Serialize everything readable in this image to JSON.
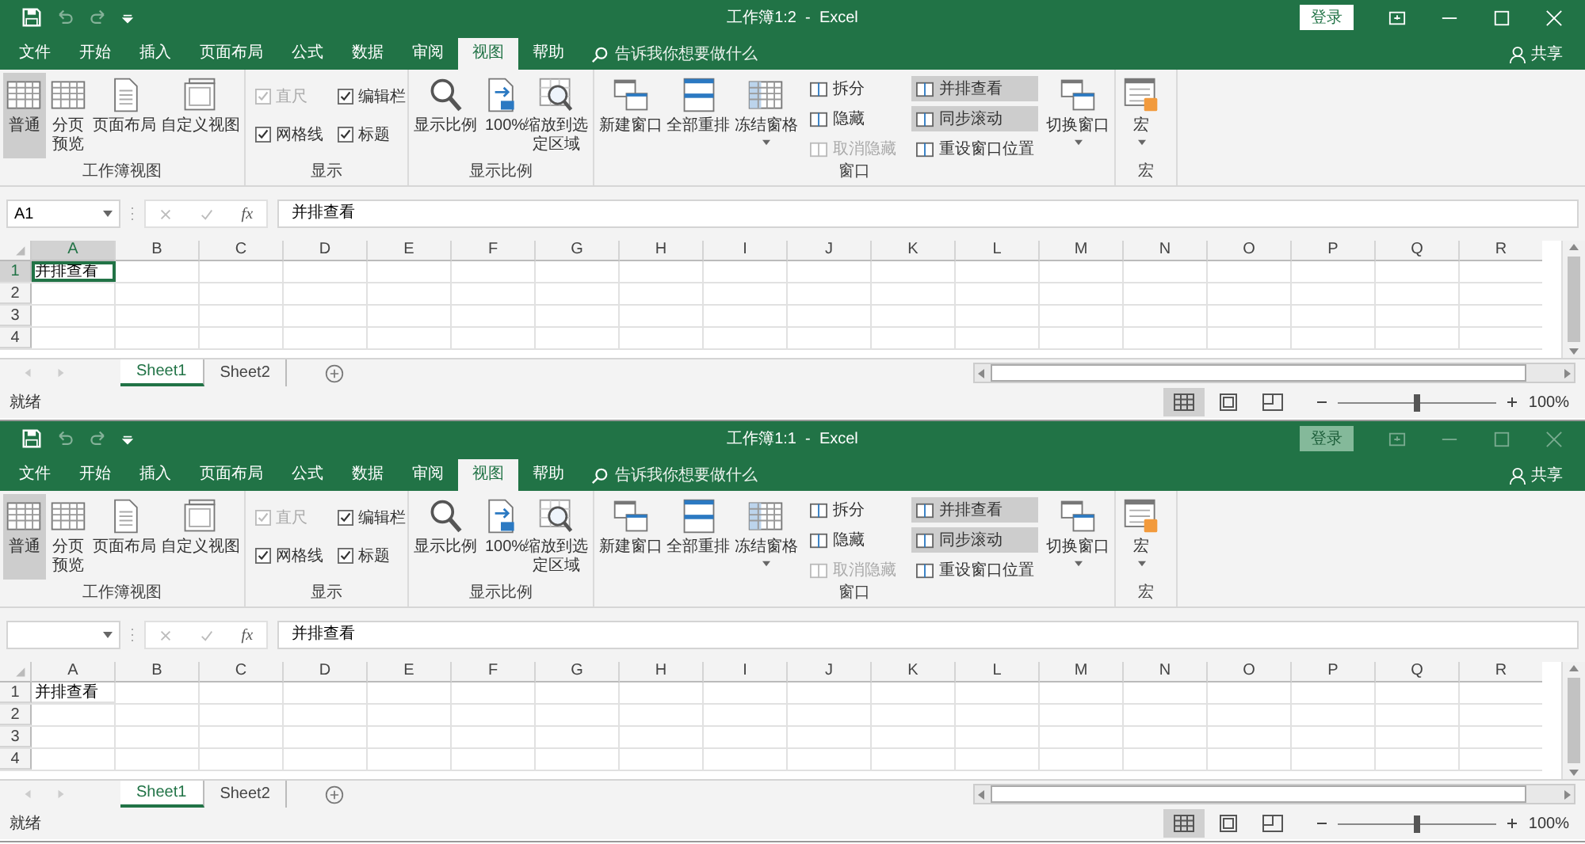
{
  "windows": [
    {
      "active": true,
      "title": "工作簿1:2  -  Excel",
      "login": "登录",
      "share": "共享",
      "tabs": [
        {
          "label": "文件",
          "selected": false
        },
        {
          "label": "开始",
          "selected": false
        },
        {
          "label": "插入",
          "selected": false
        },
        {
          "label": "页面布局",
          "selected": false
        },
        {
          "label": "公式",
          "selected": false
        },
        {
          "label": "数据",
          "selected": false
        },
        {
          "label": "审阅",
          "selected": false
        },
        {
          "label": "视图",
          "selected": true
        },
        {
          "label": "帮助",
          "selected": false
        }
      ],
      "tell_me": "告诉我你想要做什么",
      "groups": [
        {
          "label": "工作簿视图",
          "items": [
            {
              "kind": "large",
              "label": "普通",
              "selected": true
            },
            {
              "kind": "large",
              "label": "分页预览",
              "selected": false
            },
            {
              "kind": "large",
              "label": "页面布局",
              "selected": false
            },
            {
              "kind": "large",
              "label": "自定义视图",
              "selected": false
            }
          ]
        },
        {
          "label": "显示",
          "items": [
            {
              "kind": "column",
              "items": [
                {
                  "kind": "check",
                  "label": "直尺",
                  "checked": true,
                  "disabled": true
                },
                {
                  "kind": "check",
                  "label": "网格线",
                  "checked": true,
                  "disabled": false
                }
              ]
            },
            {
              "kind": "column",
              "items": [
                {
                  "kind": "check",
                  "label": "编辑栏",
                  "checked": true,
                  "disabled": false
                },
                {
                  "kind": "check",
                  "label": "标题",
                  "checked": true,
                  "disabled": false
                }
              ]
            }
          ]
        },
        {
          "label": "显示比例",
          "items": [
            {
              "kind": "large",
              "label": "显示比例",
              "selected": false
            },
            {
              "kind": "large",
              "label": "100%",
              "selected": false
            },
            {
              "kind": "large",
              "label": "缩放到选定区域",
              "selected": false
            }
          ]
        },
        {
          "label": "窗口",
          "items": [
            {
              "kind": "large",
              "label": "新建窗口",
              "selected": false
            },
            {
              "kind": "large",
              "label": "全部重排",
              "selected": false
            },
            {
              "kind": "large",
              "label": "冻结窗格",
              "selected": false,
              "dropdown": true
            },
            {
              "kind": "column",
              "items": [
                {
                  "kind": "small",
                  "label": "拆分",
                  "selected": false,
                  "disabled": false
                },
                {
                  "kind": "small",
                  "label": "隐藏",
                  "selected": false,
                  "disabled": false
                },
                {
                  "kind": "small",
                  "label": "取消隐藏",
                  "selected": false,
                  "disabled": true
                }
              ]
            },
            {
              "kind": "column",
              "items": [
                {
                  "kind": "small",
                  "label": "并排查看",
                  "selected": true,
                  "disabled": false
                },
                {
                  "kind": "small",
                  "label": "同步滚动",
                  "selected": true,
                  "disabled": false
                },
                {
                  "kind": "small",
                  "label": "重设窗口位置",
                  "selected": false,
                  "disabled": false
                }
              ]
            },
            {
              "kind": "large",
              "label": "切换窗口",
              "selected": false,
              "dropdown": true
            }
          ]
        },
        {
          "label": "宏",
          "items": [
            {
              "kind": "large",
              "label": "宏",
              "selected": false,
              "dropdown": true
            }
          ]
        }
      ],
      "name_box": "A1",
      "fx": "fx",
      "formula": "并排查看",
      "columns": [
        "A",
        "B",
        "C",
        "D",
        "E",
        "F",
        "G",
        "H",
        "I",
        "J",
        "K",
        "L",
        "M",
        "N",
        "O",
        "P",
        "Q",
        "R"
      ],
      "rows": [
        {
          "header": "1",
          "cells": [
            {
              "text": "并排查看",
              "selected": true
            }
          ]
        },
        {
          "header": "2",
          "cells": []
        },
        {
          "header": "3",
          "cells": []
        },
        {
          "header": "4",
          "cells": []
        }
      ],
      "sheets": [
        {
          "label": "Sheet1",
          "selected": true
        },
        {
          "label": "Sheet2",
          "selected": false
        }
      ],
      "status": "就绪",
      "zoom": {
        "level": 0.5,
        "reading": "100%"
      }
    },
    {
      "active": false,
      "title": "工作簿1:1  -  Excel",
      "login": "登录",
      "share": "共享",
      "tabs": [
        {
          "label": "文件",
          "selected": false
        },
        {
          "label": "开始",
          "selected": false
        },
        {
          "label": "插入",
          "selected": false
        },
        {
          "label": "页面布局",
          "selected": false
        },
        {
          "label": "公式",
          "selected": false
        },
        {
          "label": "数据",
          "selected": false
        },
        {
          "label": "审阅",
          "selected": false
        },
        {
          "label": "视图",
          "selected": true
        },
        {
          "label": "帮助",
          "selected": false
        }
      ],
      "tell_me": "告诉我你想要做什么",
      "groups": [
        {
          "label": "工作簿视图",
          "items": [
            {
              "kind": "large",
              "label": "普通",
              "selected": true
            },
            {
              "kind": "large",
              "label": "分页预览",
              "selected": false
            },
            {
              "kind": "large",
              "label": "页面布局",
              "selected": false
            },
            {
              "kind": "large",
              "label": "自定义视图",
              "selected": false
            }
          ]
        },
        {
          "label": "显示",
          "items": [
            {
              "kind": "column",
              "items": [
                {
                  "kind": "check",
                  "label": "直尺",
                  "checked": true,
                  "disabled": true
                },
                {
                  "kind": "check",
                  "label": "网格线",
                  "checked": true,
                  "disabled": false
                }
              ]
            },
            {
              "kind": "column",
              "items": [
                {
                  "kind": "check",
                  "label": "编辑栏",
                  "checked": true,
                  "disabled": false
                },
                {
                  "kind": "check",
                  "label": "标题",
                  "checked": true,
                  "disabled": false
                }
              ]
            }
          ]
        },
        {
          "label": "显示比例",
          "items": [
            {
              "kind": "large",
              "label": "显示比例",
              "selected": false
            },
            {
              "kind": "large",
              "label": "100%",
              "selected": false
            },
            {
              "kind": "large",
              "label": "缩放到选定区域",
              "selected": false
            }
          ]
        },
        {
          "label": "窗口",
          "items": [
            {
              "kind": "large",
              "label": "新建窗口",
              "selected": false
            },
            {
              "kind": "large",
              "label": "全部重排",
              "selected": false
            },
            {
              "kind": "large",
              "label": "冻结窗格",
              "selected": false,
              "dropdown": true
            },
            {
              "kind": "column",
              "items": [
                {
                  "kind": "small",
                  "label": "拆分",
                  "selected": false,
                  "disabled": false
                },
                {
                  "kind": "small",
                  "label": "隐藏",
                  "selected": false,
                  "disabled": false
                },
                {
                  "kind": "small",
                  "label": "取消隐藏",
                  "selected": false,
                  "disabled": true
                }
              ]
            },
            {
              "kind": "column",
              "items": [
                {
                  "kind": "small",
                  "label": "并排查看",
                  "selected": true,
                  "disabled": false
                },
                {
                  "kind": "small",
                  "label": "同步滚动",
                  "selected": true,
                  "disabled": false
                },
                {
                  "kind": "small",
                  "label": "重设窗口位置",
                  "selected": false,
                  "disabled": false
                }
              ]
            },
            {
              "kind": "large",
              "label": "切换窗口",
              "selected": false,
              "dropdown": true
            }
          ]
        },
        {
          "label": "宏",
          "items": [
            {
              "kind": "large",
              "label": "宏",
              "selected": false,
              "dropdown": true
            }
          ]
        }
      ],
      "fx": "fx",
      "formula": "并排查看",
      "columns": [
        "A",
        "B",
        "C",
        "D",
        "E",
        "F",
        "G",
        "H",
        "I",
        "J",
        "K",
        "L",
        "M",
        "N",
        "O",
        "P",
        "Q",
        "R"
      ],
      "rows": [
        {
          "header": "1",
          "cells": [
            {
              "text": "并排查看",
              "selected": false
            }
          ]
        },
        {
          "header": "2",
          "cells": []
        },
        {
          "header": "3",
          "cells": []
        },
        {
          "header": "4",
          "cells": []
        }
      ],
      "sheets": [
        {
          "label": "Sheet1",
          "selected": true
        },
        {
          "label": "Sheet2",
          "selected": false
        }
      ],
      "status": "就绪",
      "zoom": {
        "level": 0.5,
        "reading": "100%"
      }
    }
  ]
}
